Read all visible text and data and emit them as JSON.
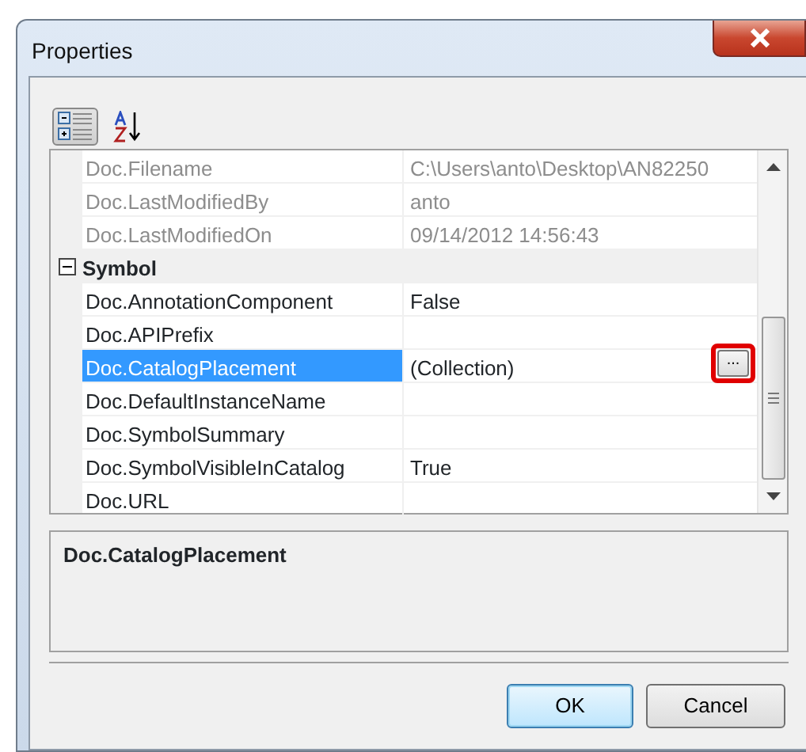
{
  "window": {
    "title": "Properties"
  },
  "toolbar": [
    {
      "kind": "categorized",
      "selected": true
    },
    {
      "kind": "alphabetical",
      "selected": false
    }
  ],
  "grid": {
    "rows": [
      {
        "kind": "property",
        "name": "Doc.Filename",
        "value": "C:\\Users\\anto\\Desktop\\AN82250",
        "readonly": true,
        "selected": false
      },
      {
        "kind": "property",
        "name": "Doc.LastModifiedBy",
        "value": "anto",
        "readonly": true,
        "selected": false
      },
      {
        "kind": "property",
        "name": "Doc.LastModifiedOn",
        "value": "09/14/2012 14:56:43",
        "readonly": true,
        "selected": false
      },
      {
        "kind": "category",
        "name": "Symbol",
        "expanded": true
      },
      {
        "kind": "property",
        "name": "Doc.AnnotationComponent",
        "value": "False",
        "readonly": false,
        "selected": false
      },
      {
        "kind": "property",
        "name": "Doc.APIPrefix",
        "readonly": false,
        "selected": false
      },
      {
        "kind": "property",
        "name": "Doc.CatalogPlacement",
        "value": "(Collection)",
        "readonly": false,
        "selected": true,
        "ellipsis_button": "...",
        "highlighted": true
      },
      {
        "kind": "property",
        "name": "Doc.DefaultInstanceName",
        "readonly": false,
        "selected": false
      },
      {
        "kind": "property",
        "name": "Doc.SymbolSummary",
        "readonly": false,
        "selected": false
      },
      {
        "kind": "property",
        "name": "Doc.SymbolVisibleInCatalog",
        "value": "True",
        "readonly": false,
        "selected": false
      },
      {
        "kind": "property",
        "name": "Doc.URL",
        "readonly": false,
        "selected": false
      }
    ]
  },
  "description": {
    "title": "Doc.CatalogPlacement"
  },
  "buttons": [
    {
      "label": "OK",
      "default": true
    },
    {
      "label": "Cancel",
      "default": false
    }
  ]
}
